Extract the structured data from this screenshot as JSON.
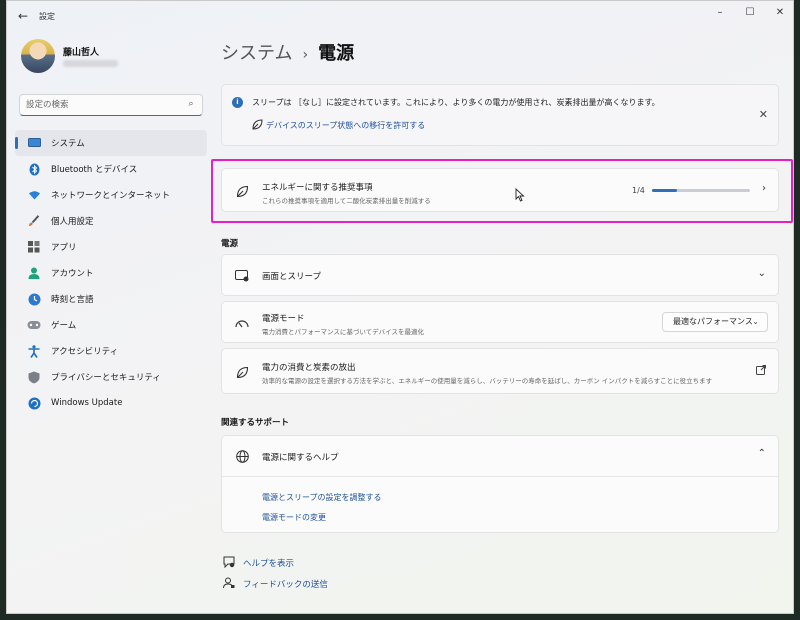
{
  "window": {
    "title": "設定"
  },
  "user": {
    "name": "藤山哲人"
  },
  "search": {
    "placeholder": "設定の検索"
  },
  "sidebar": {
    "items": [
      {
        "label": "システム",
        "icon": "monitor-icon",
        "active": true
      },
      {
        "label": "Bluetooth とデバイス",
        "icon": "bluetooth-icon"
      },
      {
        "label": "ネットワークとインターネット",
        "icon": "wifi-icon"
      },
      {
        "label": "個人用設定",
        "icon": "brush-icon"
      },
      {
        "label": "アプリ",
        "icon": "apps-icon"
      },
      {
        "label": "アカウント",
        "icon": "person-icon"
      },
      {
        "label": "時刻と言語",
        "icon": "clock-globe-icon"
      },
      {
        "label": "ゲーム",
        "icon": "gamepad-icon"
      },
      {
        "label": "アクセシビリティ",
        "icon": "accessibility-icon"
      },
      {
        "label": "プライバシーとセキュリティ",
        "icon": "shield-icon"
      },
      {
        "label": "Windows Update",
        "icon": "update-icon"
      }
    ]
  },
  "breadcrumb": {
    "parent": "システム",
    "separator": "›",
    "current": "電源"
  },
  "info": {
    "text": "スリープは ［なし］に設定されています。これにより、より多くの電力が使用され、炭素排出量が高くなります。",
    "link": "デバイスのスリープ状態への移行を許可する"
  },
  "recommendation": {
    "title": "エネルギーに関する推奨事項",
    "subtitle": "これらの推奨事項を適用して二酸化炭素排出量を削減する",
    "progress_text": "1/4",
    "progress": 0.25
  },
  "power_section": {
    "label": "電源",
    "screen_sleep": {
      "title": "画面とスリープ"
    },
    "power_mode": {
      "title": "電源モード",
      "subtitle": "電力消費とパフォーマンスに基づいてデバイスを最適化",
      "value": "最適なパフォーマンス"
    },
    "consumption": {
      "title": "電力の消費と炭素の放出",
      "subtitle": "効率的な電源の設定を選択する方法を学ぶと、エネルギーの使用量を減らし、バッテリーの寿命を延ばし、カーボン インパクトを減らすことに役立ちます"
    }
  },
  "support": {
    "label": "関連するサポート",
    "help_title": "電源に関するヘルプ",
    "links": [
      "電源とスリープの設定を調整する",
      "電源モードの変更"
    ]
  },
  "footer": {
    "help": "ヘルプを表示",
    "feedback": "フィードバックの送信"
  },
  "colors": {
    "accent": "#2f6fb5",
    "highlight": "#e81fc8",
    "link": "#1d4f9a"
  }
}
